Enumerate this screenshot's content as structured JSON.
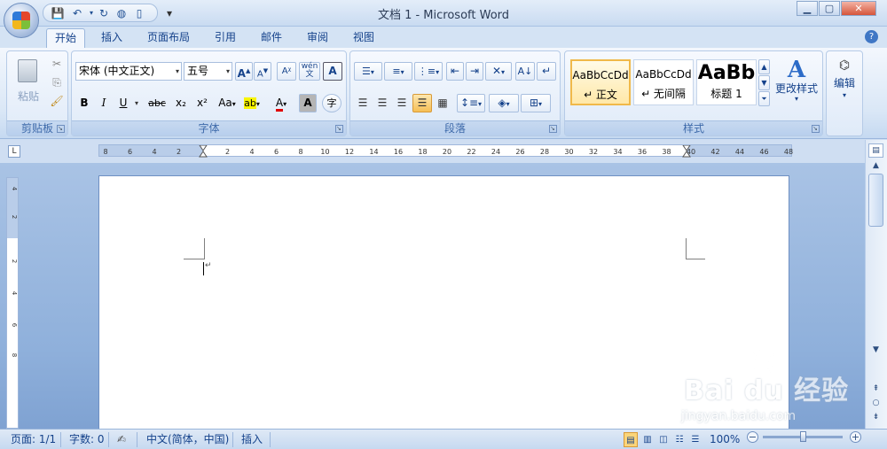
{
  "window": {
    "title": "文档 1 - Microsoft Word",
    "minimize": "▁",
    "maximize": "▢",
    "close": "✕"
  },
  "qat": {
    "save": "💾",
    "undo": "↶",
    "redo": "↻",
    "custom": "▾"
  },
  "tabs": [
    {
      "label": "开始",
      "active": true
    },
    {
      "label": "插入"
    },
    {
      "label": "页面布局"
    },
    {
      "label": "引用"
    },
    {
      "label": "邮件"
    },
    {
      "label": "审阅"
    },
    {
      "label": "视图"
    }
  ],
  "help": "?",
  "clipboard": {
    "paste": "粘贴",
    "group": "剪贴板"
  },
  "font": {
    "name": "宋体 (中文正文)",
    "size": "五号",
    "grow": "A",
    "shrink": "A",
    "bold": "B",
    "italic": "I",
    "underline": "U",
    "strike": "abc",
    "sub": "x₂",
    "sup": "x²",
    "case": "Aa",
    "highlight": "ab",
    "color": "A",
    "shade": "A",
    "enclose": "字",
    "pinyin": "wén",
    "border": "A",
    "group": "字体"
  },
  "paragraph": {
    "group": "段落"
  },
  "styles": {
    "items": [
      {
        "sample": "AaBbCcDd",
        "name": "↵ 正文"
      },
      {
        "sample": "AaBbCcDd",
        "name": "↵ 无间隔"
      },
      {
        "sample": "AaBb",
        "name": "标题 1"
      }
    ],
    "change": "更改样式",
    "group": "样式"
  },
  "editing": {
    "label": "编辑"
  },
  "ruler": {
    "ticks": [
      "8",
      "6",
      "4",
      "2",
      "2",
      "4",
      "6",
      "8",
      "10",
      "12",
      "14",
      "16",
      "18",
      "20",
      "22",
      "24",
      "26",
      "28",
      "30",
      "32",
      "34",
      "36",
      "38",
      "40",
      "42",
      "44",
      "46",
      "48"
    ]
  },
  "vruler": {
    "ticks": [
      "4",
      "2",
      "2",
      "4",
      "6",
      "8"
    ]
  },
  "document": {
    "para_mark": "↵"
  },
  "status": {
    "page": "页面: 1/1",
    "words": "字数: 0",
    "language": "中文(简体，中国)",
    "mode": "插入",
    "zoom": "100%"
  },
  "watermark": {
    "text": "Bai du 经验",
    "url": "jingyan.baidu.com"
  }
}
